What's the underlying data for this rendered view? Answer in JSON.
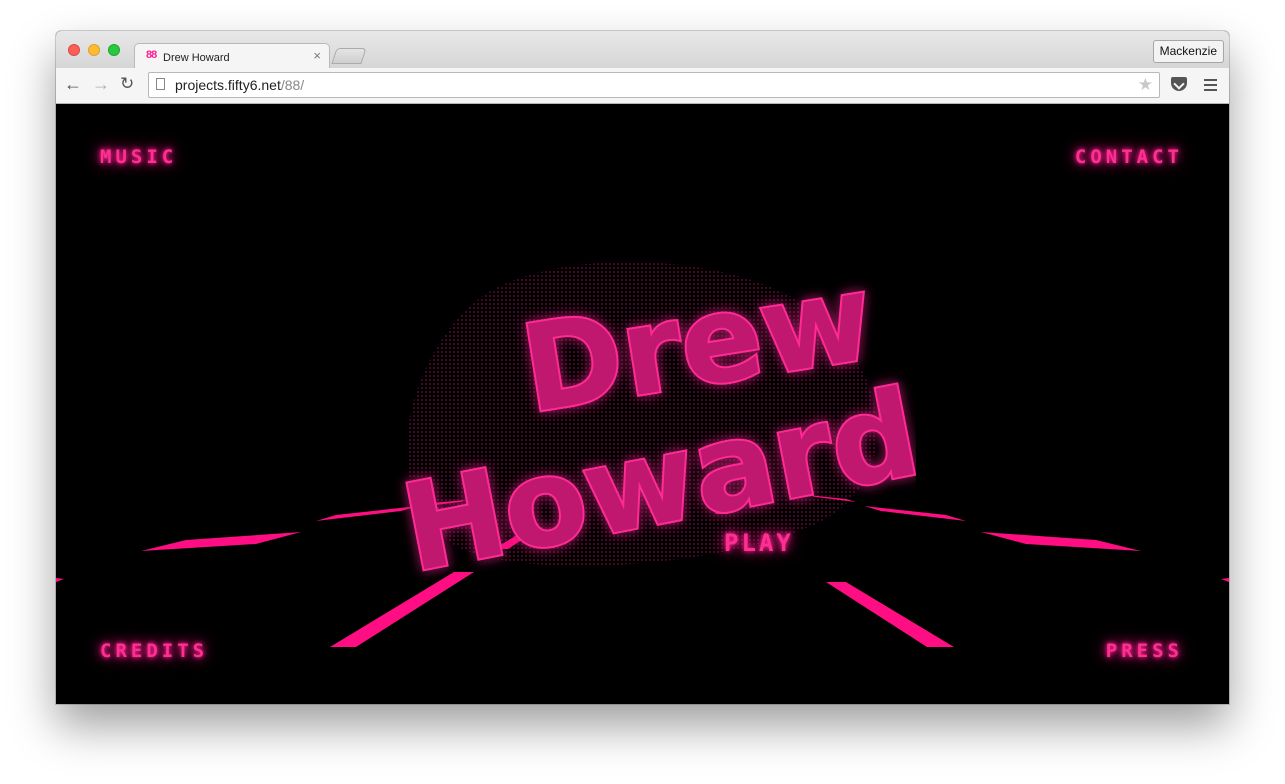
{
  "browser": {
    "tab": {
      "favicon": "88",
      "title": "Drew Howard",
      "close": "×"
    },
    "profile": "Mackenzie",
    "url": {
      "host": "projects.fifty6.net",
      "path": "/88/"
    },
    "icons": {
      "back": "←",
      "forward": "→",
      "reload": "↻",
      "star": "★"
    }
  },
  "page": {
    "accent_color": "#ff1f8e",
    "nav": {
      "music": "MUSIC",
      "contact": "CONTACT",
      "credits": "CREDITS",
      "press": "PRESS"
    },
    "logo": {
      "line1": "Drew",
      "line2": "Howard"
    },
    "play": "PLAY"
  }
}
